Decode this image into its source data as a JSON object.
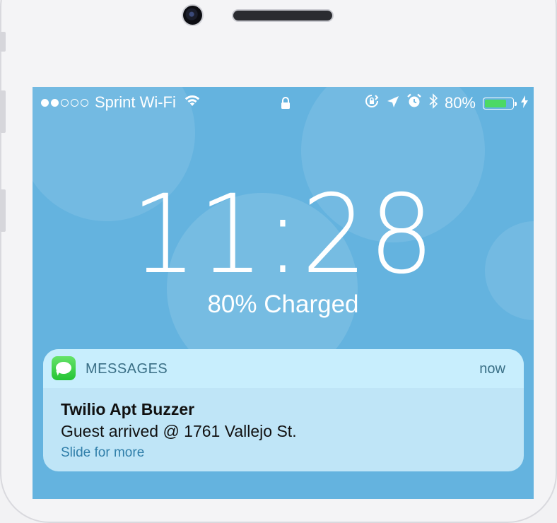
{
  "status_bar": {
    "signal_filled": 2,
    "signal_total": 5,
    "carrier": "Sprint Wi-Fi",
    "battery_percent": "80%",
    "battery_level": 0.8,
    "icons": [
      "wifi-icon",
      "lock-icon",
      "rotation-lock-icon",
      "location-arrow-icon",
      "alarm-icon",
      "bluetooth-icon",
      "battery-icon",
      "charging-bolt-icon"
    ]
  },
  "lock_screen": {
    "time": "11:28",
    "charge_status": "80% Charged"
  },
  "notification": {
    "app_name": "MESSAGES",
    "time": "now",
    "title": "Twilio Apt Buzzer",
    "body": "Guest arrived @ 1761 Vallejo St.",
    "action_hint": "Slide for more"
  },
  "colors": {
    "screen_bg": "#64b3df",
    "battery_fill": "#4cd964",
    "messages_green": "#34c759"
  }
}
